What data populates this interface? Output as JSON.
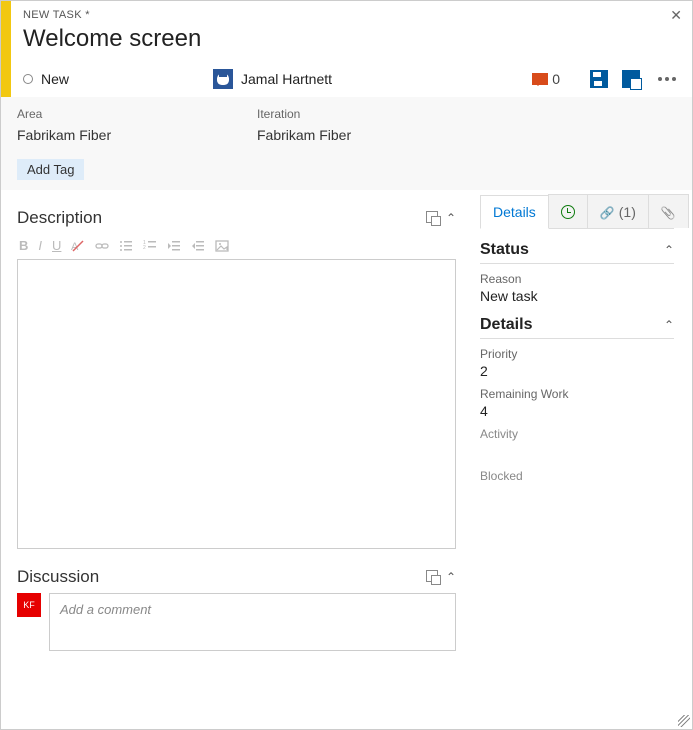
{
  "breadcrumb": "NEW TASK *",
  "title": "Welcome screen",
  "state": "New",
  "assignee": "Jamal Hartnett",
  "comment_count": "0",
  "fields": {
    "area_label": "Area",
    "area_value": "Fabrikam Fiber",
    "iteration_label": "Iteration",
    "iteration_value": "Fabrikam Fiber"
  },
  "add_tag": "Add Tag",
  "tabs": {
    "details": "Details",
    "links_count": "(1)"
  },
  "sections": {
    "description": "Description",
    "discussion": "Discussion"
  },
  "discussion": {
    "placeholder": "Add a comment",
    "avatar_initials": "KF"
  },
  "side": {
    "status_title": "Status",
    "reason_label": "Reason",
    "reason_value": "New task",
    "details_title": "Details",
    "priority_label": "Priority",
    "priority_value": "2",
    "remaining_label": "Remaining Work",
    "remaining_value": "4",
    "activity_label": "Activity",
    "blocked_label": "Blocked"
  }
}
